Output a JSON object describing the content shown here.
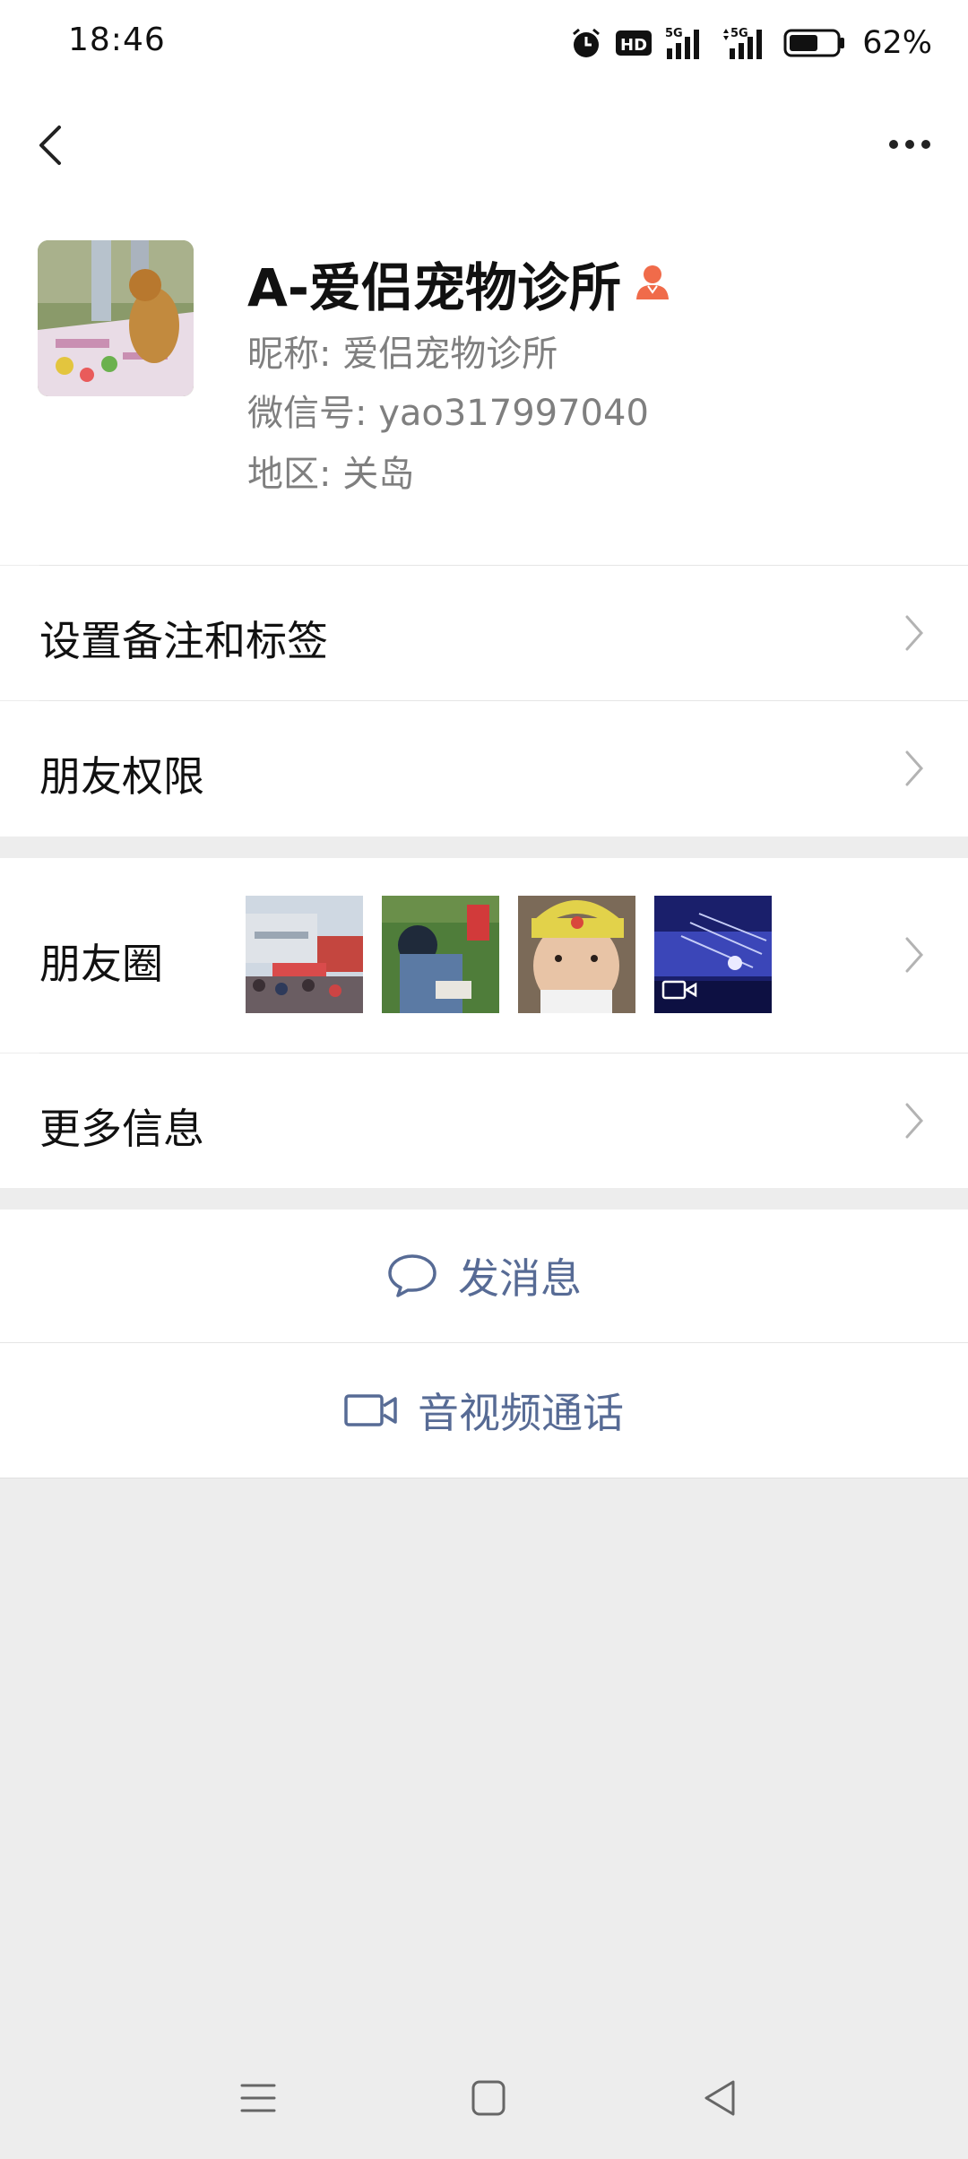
{
  "status_bar": {
    "time": "18:46",
    "battery_percent": "62%",
    "battery_level": 0.62,
    "icons": [
      "alarm-icon",
      "hd-icon",
      "signal-5g-icon",
      "signal-5g-icon-2",
      "battery-icon"
    ]
  },
  "navbar": {
    "back_icon": "chevron-left-icon",
    "more_icon": "more-dots-icon"
  },
  "profile": {
    "display_name": "A-爱侣宠物诊所",
    "badge_icon": "person-icon",
    "nickname": "昵称:  爱侣宠物诊所",
    "wechat_id": "微信号:  yao317997040",
    "region": "地区:  关岛"
  },
  "rows": {
    "remark_tags": "设置备注和标签",
    "friend_permissions": "朋友权限",
    "moments": "朋友圈",
    "more_info": "更多信息"
  },
  "moments_thumbnails": [
    {
      "name": "moments-thumb-event",
      "video": false
    },
    {
      "name": "moments-thumb-child",
      "video": false
    },
    {
      "name": "moments-thumb-baby",
      "video": false
    },
    {
      "name": "moments-thumb-concert",
      "video": true
    }
  ],
  "actions": {
    "send_message": "发消息",
    "av_call": "音视频通话"
  },
  "colors": {
    "accent": "#576b95",
    "background": "#ededed",
    "badge": "#f06b4a"
  }
}
